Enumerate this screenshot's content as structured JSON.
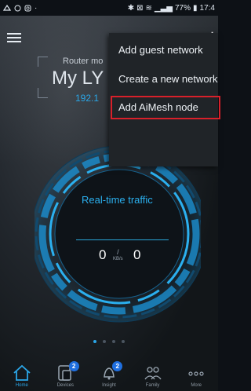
{
  "status_bar": {
    "left_icons": [
      "asus-icon",
      "whatsapp-icon",
      "instagram-icon"
    ],
    "right_text": "77%",
    "time": "17:4"
  },
  "header": {
    "router_mode": "Router mo",
    "device_name": "My LY",
    "ip": "192.1"
  },
  "menu": {
    "items": [
      {
        "label": "Add guest network"
      },
      {
        "label": "Create a new network"
      },
      {
        "label": "Add AiMesh node"
      }
    ]
  },
  "traffic": {
    "label": "Real-time traffic",
    "upload": "0",
    "download": "0",
    "unit_top": "/",
    "unit_bottom": "KB/s"
  },
  "page_dots": {
    "count": 5,
    "active_index": 0
  },
  "bottom_nav": {
    "items": [
      {
        "label": "Home",
        "icon": "home-icon",
        "badge": ""
      },
      {
        "label": "Devices",
        "icon": "devices-icon",
        "badge": "2"
      },
      {
        "label": "Insight",
        "icon": "bell-icon",
        "badge": "2"
      },
      {
        "label": "Family",
        "icon": "family-icon",
        "badge": ""
      },
      {
        "label": "More",
        "icon": "more-icon",
        "badge": ""
      }
    ]
  },
  "colors": {
    "accent": "#2ba6e8",
    "highlight_border": "#d8202a",
    "menu_bg": "#202428"
  }
}
